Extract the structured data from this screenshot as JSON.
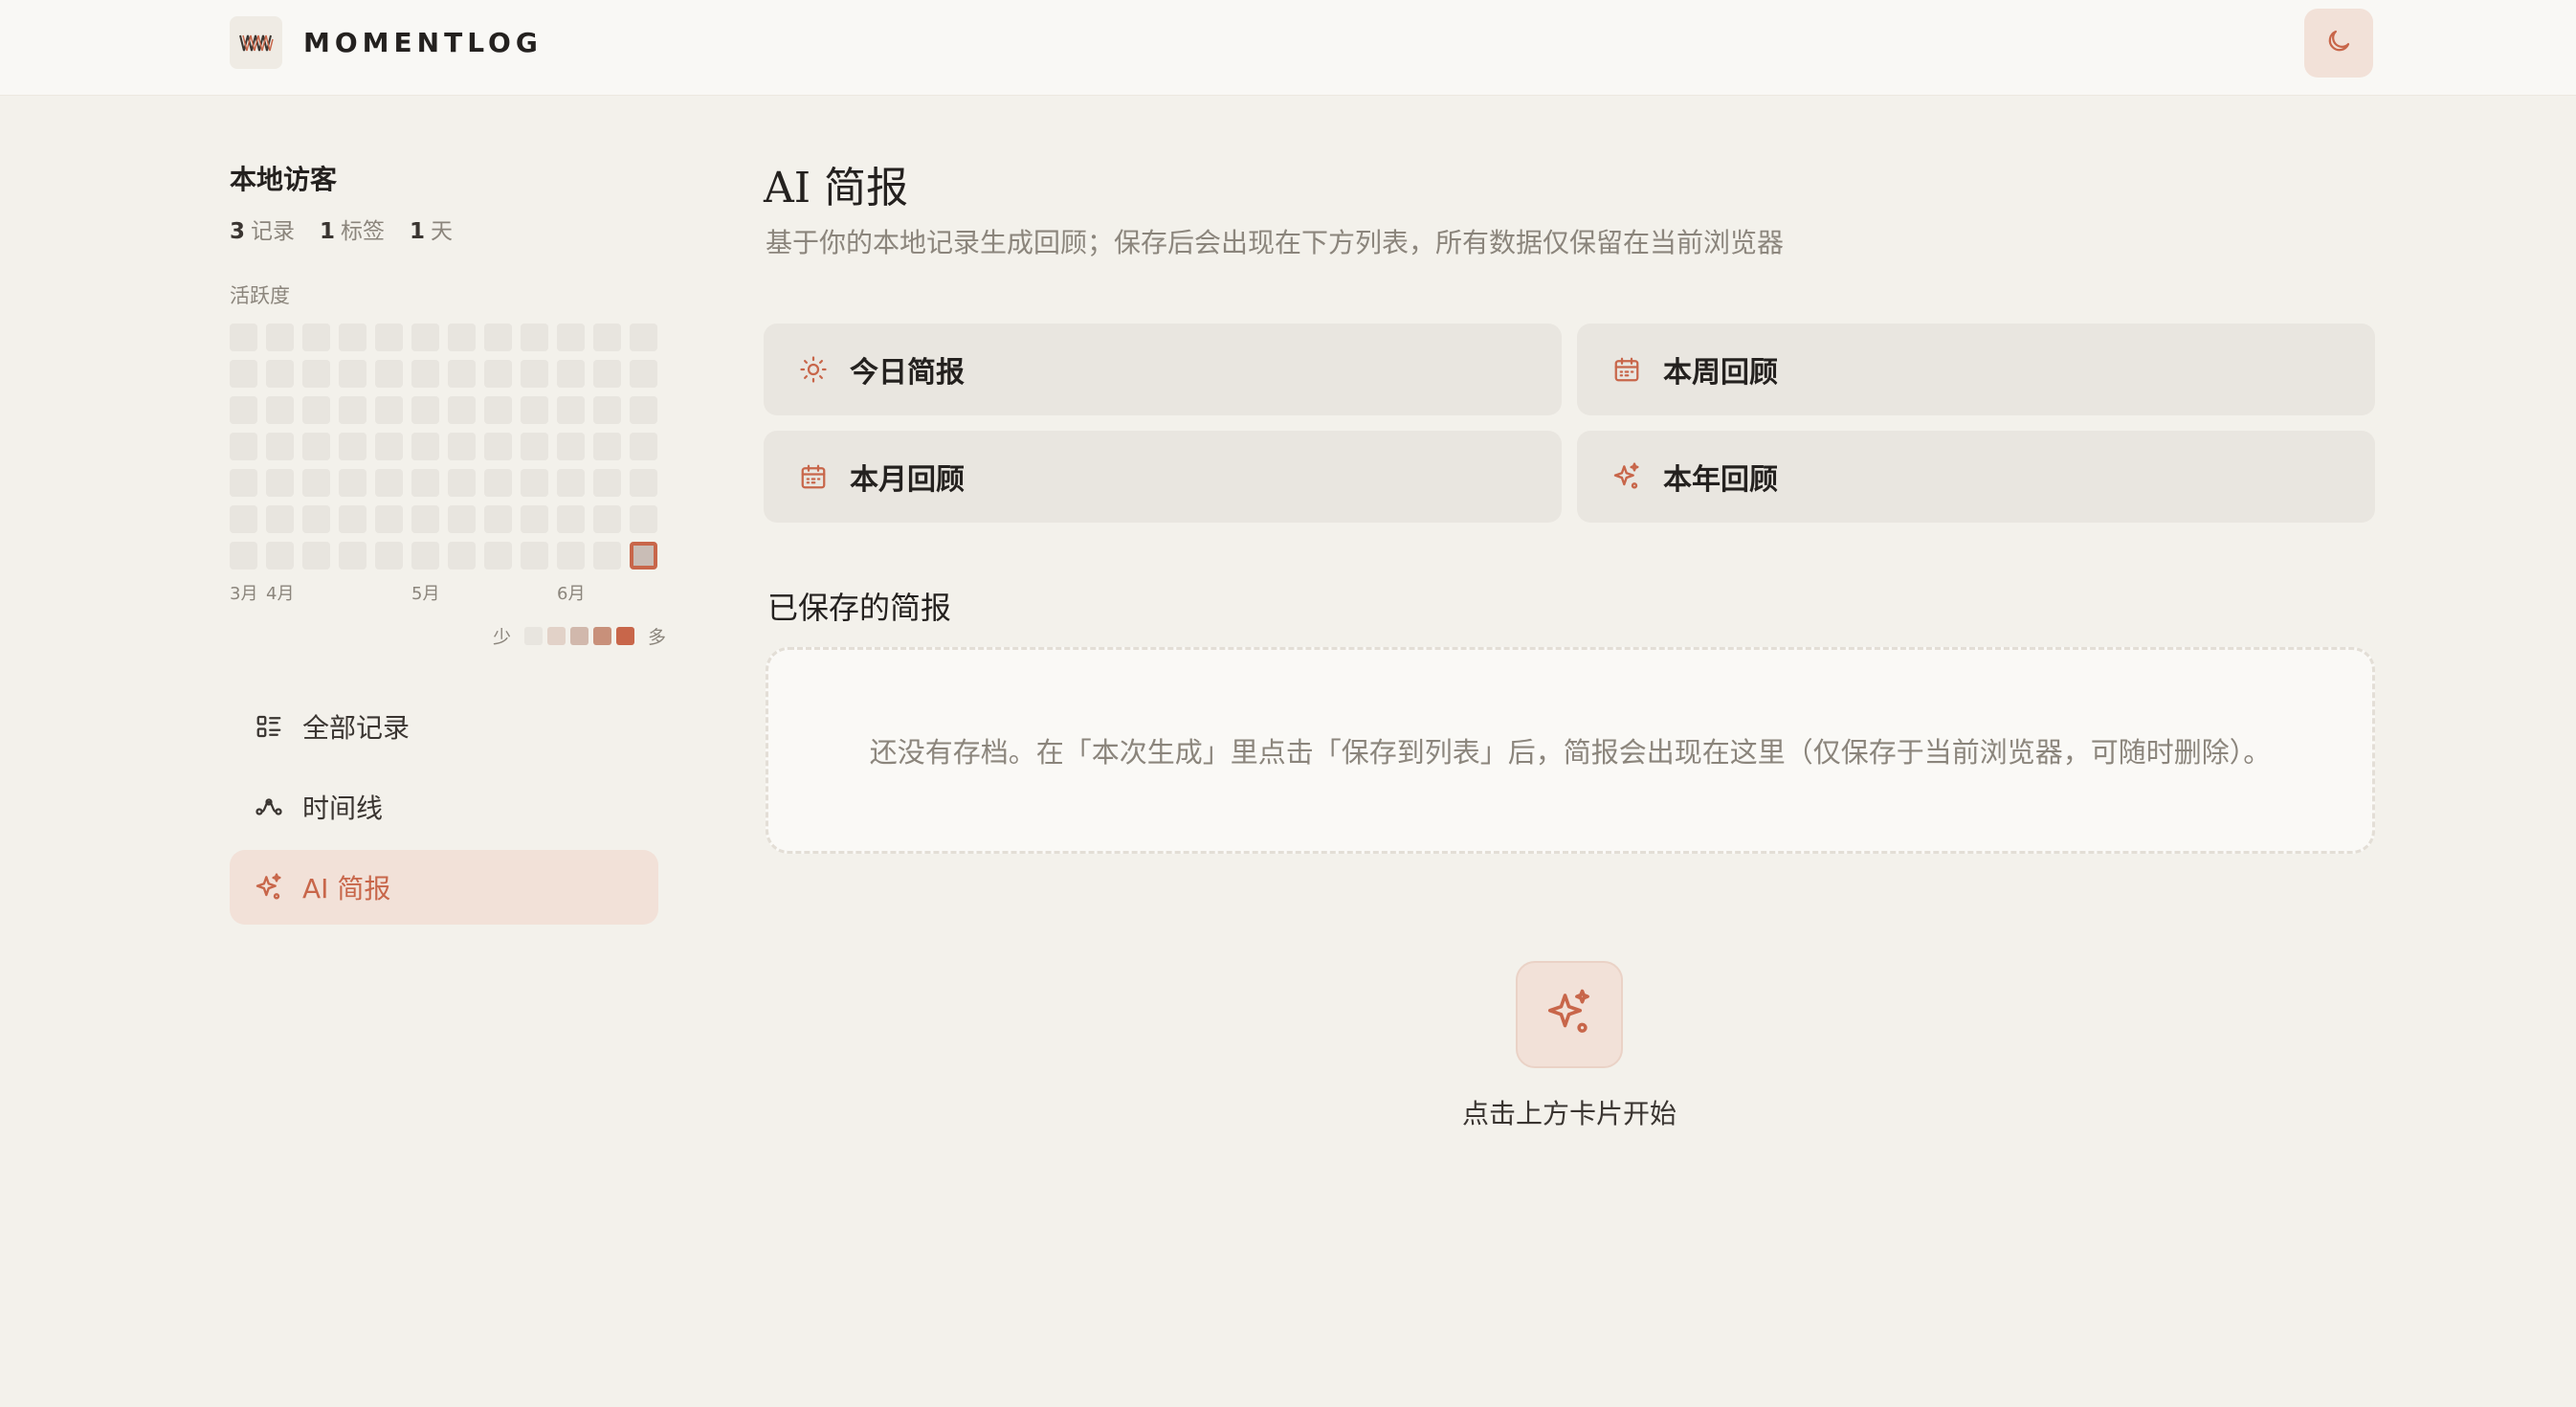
{
  "header": {
    "logo_text": "MOMENTLOG",
    "logo_icon": "zigzag-logo-icon",
    "theme_toggle_icon": "moon-icon"
  },
  "sidebar": {
    "user_name": "本地访客",
    "stats": [
      {
        "value": "3",
        "label": "记录"
      },
      {
        "value": "1",
        "label": "标签"
      },
      {
        "value": "1",
        "label": "天"
      }
    ],
    "activity_label": "活跃度",
    "heatmap": {
      "weeks": 12,
      "days": 7,
      "active_cells": [
        {
          "week": 11,
          "day": 6,
          "level": 1
        }
      ]
    },
    "month_labels": [
      "3月",
      "4月",
      "5月",
      "6月"
    ],
    "legend_less": "少",
    "legend_more": "多",
    "legend_colors": [
      "#e8e5df",
      "#e2d2c8",
      "#d1b8ac",
      "#c8907a",
      "#c8664a"
    ],
    "nav": [
      {
        "label": "全部记录",
        "icon": "list-icon",
        "active": false
      },
      {
        "label": "时间线",
        "icon": "timeline-icon",
        "active": false
      },
      {
        "label": "AI 简报",
        "icon": "sparkles-icon",
        "active": true
      }
    ]
  },
  "main": {
    "title": "AI 简报",
    "subtitle": "基于你的本地记录生成回顾；保存后会出现在下方列表，所有数据仅保留在当前浏览器",
    "cards": [
      {
        "label": "今日简报",
        "icon": "sun-icon"
      },
      {
        "label": "本周回顾",
        "icon": "calendar-icon"
      },
      {
        "label": "本月回顾",
        "icon": "calendar-icon"
      },
      {
        "label": "本年回顾",
        "icon": "sparkles-icon"
      }
    ],
    "saved_title": "已保存的简报",
    "empty_text": "还没有存档。在「本次生成」里点击「保存到列表」后，简报会出现在这里（仅保存于当前浏览器，可随时删除）。",
    "start_hint": "点击上方卡片开始"
  },
  "colors": {
    "accent": "#c8664a",
    "accent_bg": "#f2e1d8",
    "page_bg": "#f3f1eb",
    "card_bg": "#e9e6e0"
  }
}
